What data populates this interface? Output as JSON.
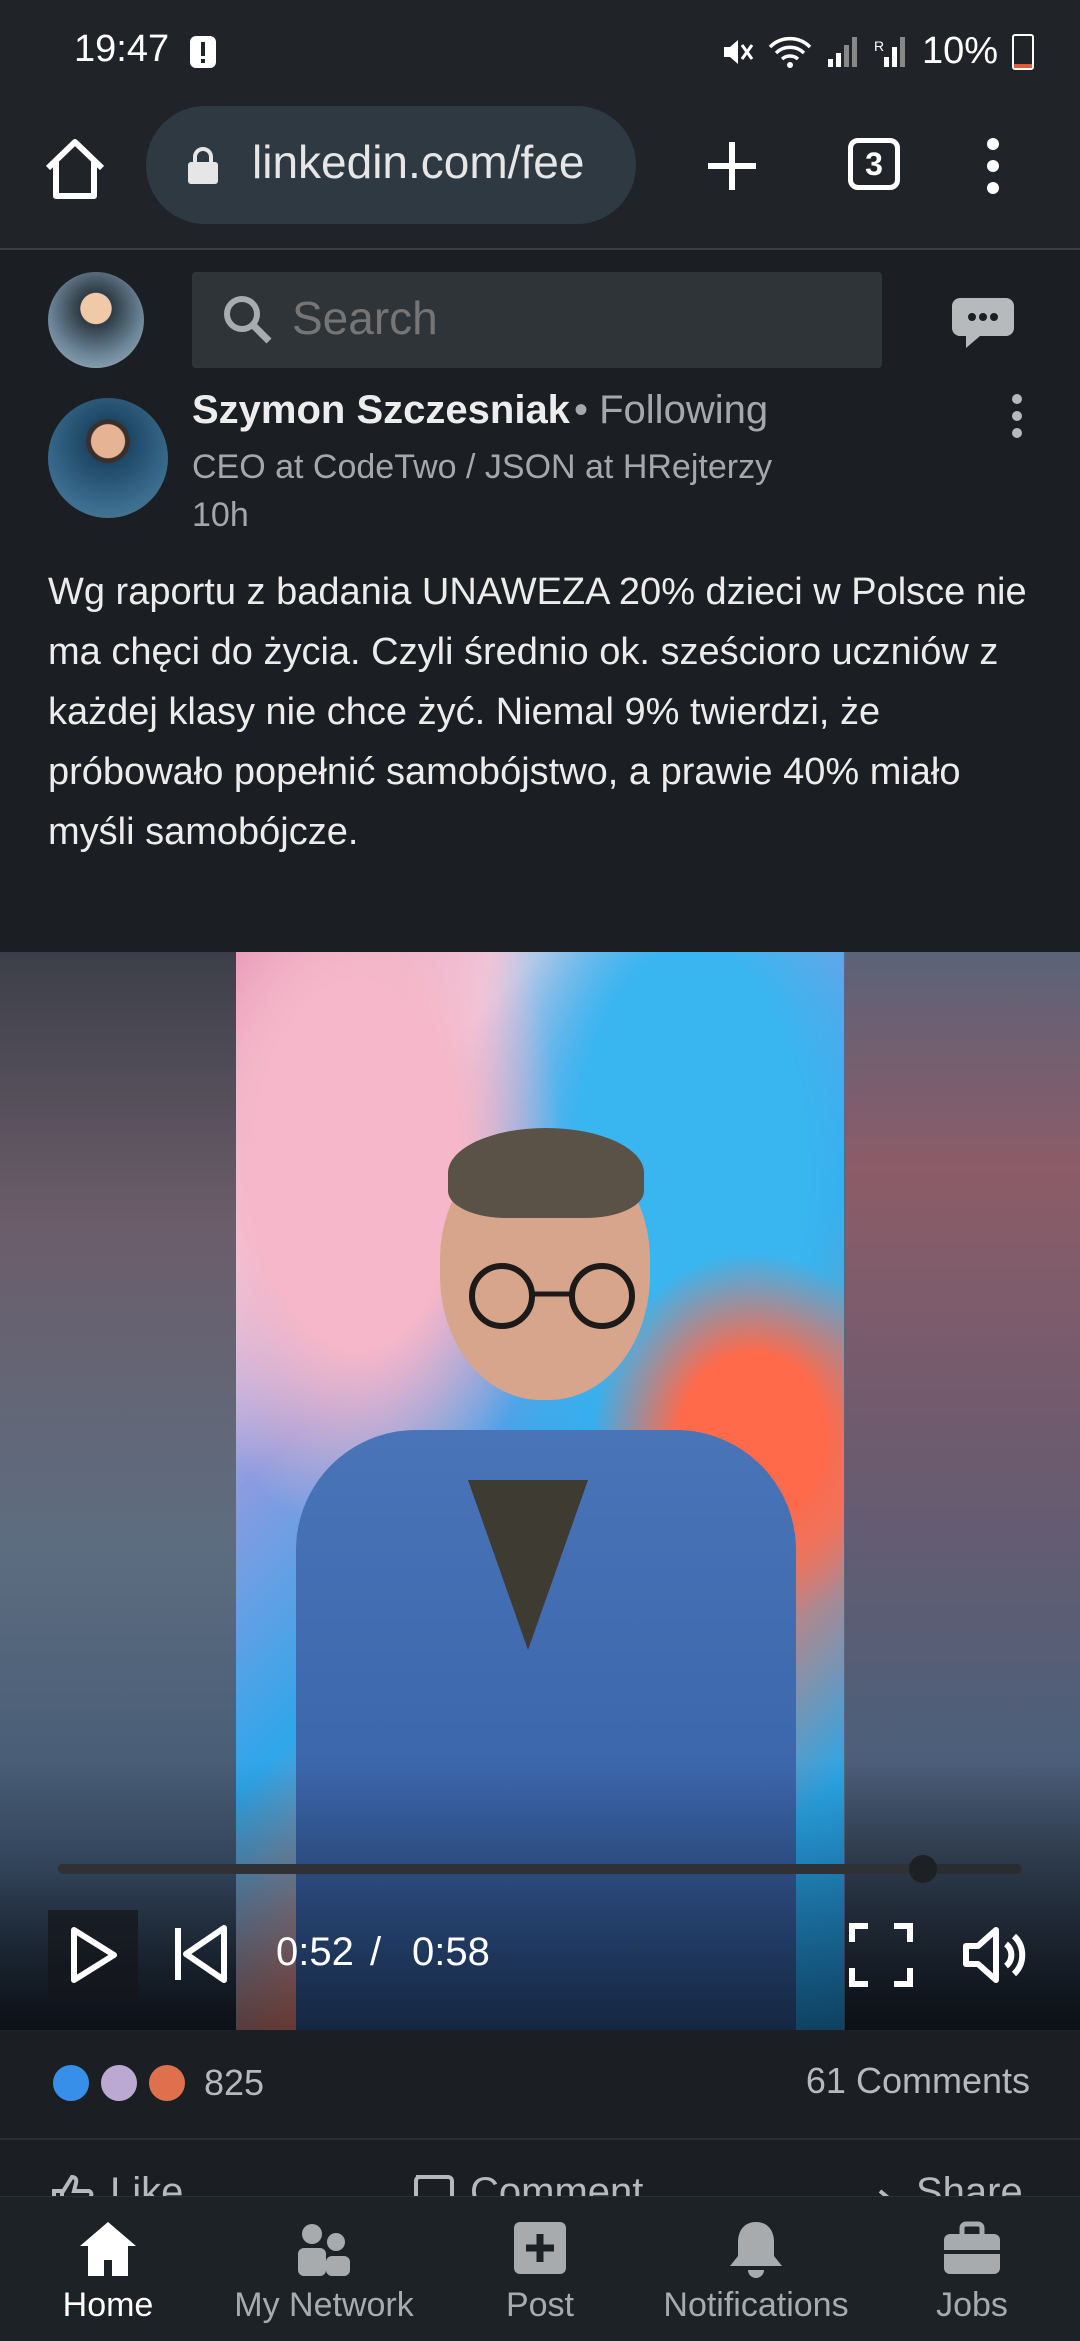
{
  "status_bar": {
    "time": "19:47",
    "battery": "10%",
    "icons": [
      "alert-icon",
      "mute-icon",
      "wifi-icon",
      "signal-icon",
      "signal-r-icon",
      "battery-low-icon"
    ]
  },
  "browser": {
    "url": "linkedin.com/fee",
    "tab_count": "3",
    "icons": [
      "home-icon",
      "lock-icon",
      "plus-icon",
      "more-vertical-icon"
    ]
  },
  "header": {
    "search_placeholder": "Search"
  },
  "post": {
    "author_name": "Szymon Szczesniak",
    "follow_status": "• Following",
    "headline": "CEO at CodeTwo / JSON at HRejterzy",
    "time": "10h",
    "text": "Wg raportu z badania UNAWEZA 20% dzieci w Polsce nie ma chęci do życia. Czyli średnio ok. sześcioro uczniów z każdej klasy nie chce żyć. Niemal 9% twierdzi, że próbowało popełnić samobójstwo, a prawie 40% miało myśli samobójcze."
  },
  "video": {
    "current_time": "0:52",
    "separator": "/",
    "total_time": "0:58",
    "progress": 0.897
  },
  "social": {
    "reaction_count": "825",
    "comments": "61 Comments",
    "reactions": [
      "like-reaction-icon",
      "support-reaction-icon",
      "love-reaction-icon"
    ]
  },
  "actions": {
    "like": "Like",
    "comment": "Comment",
    "share": "Share"
  },
  "nav": {
    "items": [
      {
        "label": "Home",
        "icon": "home-icon",
        "active": true
      },
      {
        "label": "My Network",
        "icon": "network-icon",
        "active": false
      },
      {
        "label": "Post",
        "icon": "post-icon",
        "active": false
      },
      {
        "label": "Notifications",
        "icon": "bell-icon",
        "active": false
      },
      {
        "label": "Jobs",
        "icon": "briefcase-icon",
        "active": false
      }
    ]
  },
  "colors": {
    "background": "#1b1f23",
    "like_blue": "#378fe9",
    "love_orange": "#df704d",
    "battery_low": "#e35a3a"
  }
}
